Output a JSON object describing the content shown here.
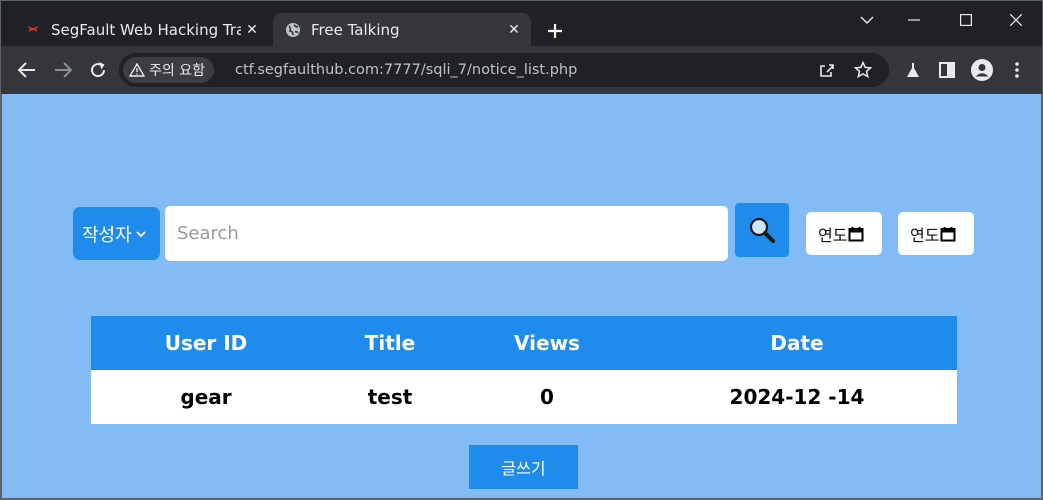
{
  "browser": {
    "tabs": [
      {
        "title": "SegFault Web Hacking Trai",
        "favicon": "segfault-logo-icon",
        "active": false
      },
      {
        "title": "Free Talking",
        "favicon": "globe-icon",
        "active": true
      }
    ],
    "security_label": "주의 요함",
    "url": "ctf.segfaulthub.com:7777/sqli_7/notice_list.php"
  },
  "search": {
    "filter_selected": "작성자",
    "placeholder": "Search",
    "date_from": "연도",
    "date_to": "연도"
  },
  "table": {
    "headers": [
      "User ID",
      "Title",
      "Views",
      "Date"
    ],
    "rows": [
      {
        "user_id": "gear",
        "title": "test",
        "views": "0",
        "date": "2024-12 -14"
      }
    ]
  },
  "write_button": "글쓰기",
  "colors": {
    "page_background": "#83BCF5",
    "accent": "#1F8BEB"
  }
}
